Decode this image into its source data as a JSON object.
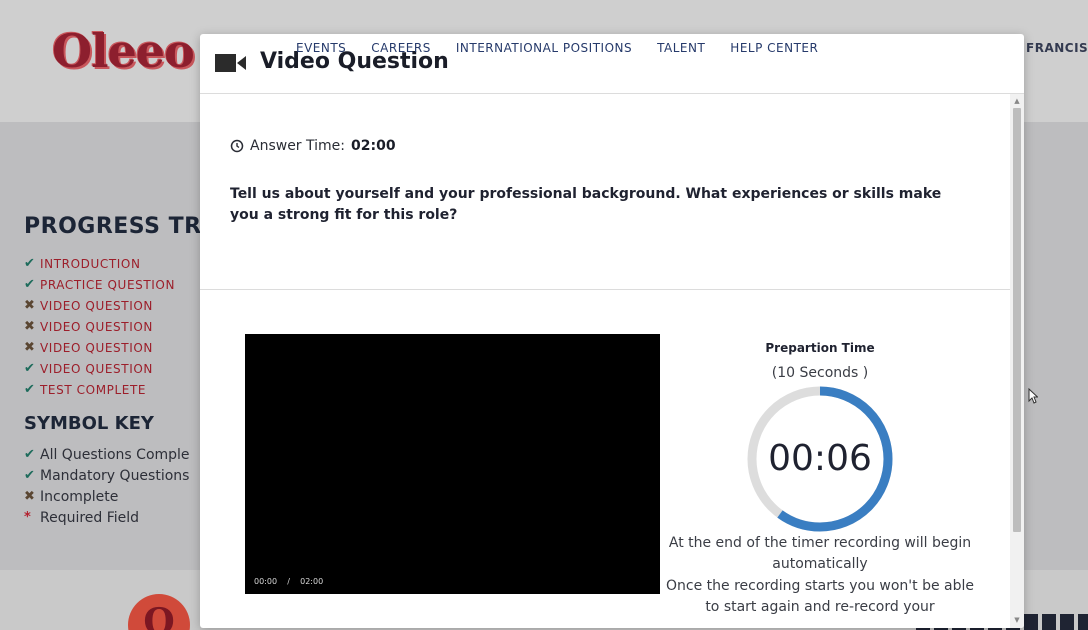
{
  "background": {
    "logo_text": "Oleeo",
    "user_name": "FRANCIS",
    "progress": {
      "title": "PROGRESS TR",
      "items": [
        {
          "label": "INTRODUCTION",
          "status": "check"
        },
        {
          "label": "PRACTICE QUESTION",
          "status": "check"
        },
        {
          "label": "VIDEO QUESTION",
          "status": "cross"
        },
        {
          "label": "VIDEO QUESTION",
          "status": "cross"
        },
        {
          "label": "VIDEO QUESTION",
          "status": "cross"
        },
        {
          "label": "VIDEO QUESTION",
          "status": "check"
        },
        {
          "label": "TEST COMPLETE",
          "status": "check"
        }
      ]
    },
    "symbol_key": {
      "title": "SYMBOL KEY",
      "items": [
        {
          "label": "All Questions Comple",
          "symbol": "check"
        },
        {
          "label": "Mandatory Questions",
          "symbol": "check"
        },
        {
          "label": "Incomplete",
          "symbol": "cross"
        },
        {
          "label": "Required Field",
          "symbol": "*"
        }
      ]
    },
    "footer_badge": "O"
  },
  "nav": [
    "EVENTS",
    "CAREERS",
    "INTERNATIONAL POSITIONS",
    "TALENT",
    "HELP CENTER"
  ],
  "modal": {
    "title": "Video Question",
    "icon": "video-camera-icon",
    "answer_time_label": "Answer Time:",
    "answer_time_value": "02:00",
    "question": "Tell us about yourself and your professional background. What experiences or skills make you a strong fit for this role?",
    "video_current": "00:00",
    "video_separator": "/",
    "video_total": "02:00",
    "prep_title": "Prepartion Time",
    "prep_subtitle": "(10 Seconds )",
    "timer_value": "00:06",
    "timer_progress": 0.6,
    "note_1": "At the end of the timer recording will begin automatically",
    "note_2": "Once the recording starts you won't be able to start again and re-record your"
  },
  "colors": {
    "accent": "#3a7ec2",
    "ring_track": "#dddddd",
    "brand": "#8d1f2e"
  }
}
